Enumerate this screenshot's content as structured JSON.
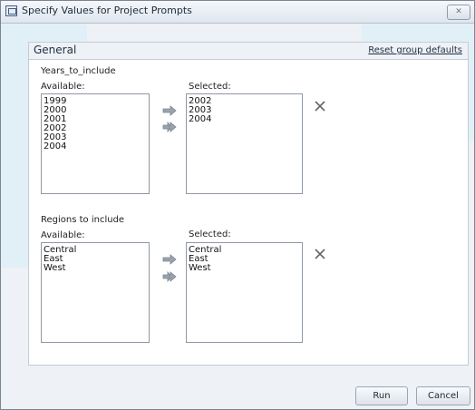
{
  "window": {
    "title": "Specify Values for Project Prompts",
    "close_glyph": "✕"
  },
  "group": {
    "title": "General",
    "reset_label": "Reset group defaults"
  },
  "prompts": [
    {
      "label": "Years_to_include",
      "available_label": "Available:",
      "selected_label": "Selected:",
      "available": [
        "1999",
        "2000",
        "2001",
        "2002",
        "2003",
        "2004"
      ],
      "selected": [
        "2002",
        "2003",
        "2004"
      ]
    },
    {
      "label": "Regions to include",
      "available_label": "Available:",
      "selected_label": "Selected:",
      "available": [
        "Central",
        "East",
        "West"
      ],
      "selected": [
        "Central",
        "East",
        "West"
      ]
    }
  ],
  "buttons": {
    "run": "Run",
    "cancel": "Cancel"
  },
  "colors": {
    "watermark": "#d9f0f8",
    "arrow_fill": "#9aa3ad"
  }
}
